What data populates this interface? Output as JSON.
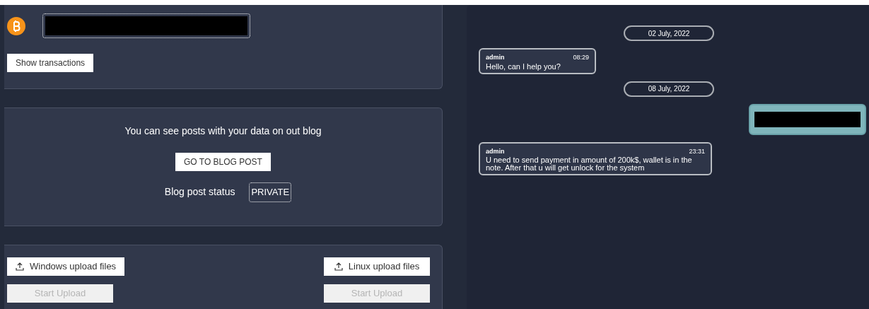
{
  "wallet": {
    "button": "Show transactions"
  },
  "blog": {
    "message": "You can see posts with your data on out blog",
    "button": "GO TO BLOG POST",
    "status_label": "Blog post status",
    "status": "PRIVATE"
  },
  "uploads": [
    {
      "label": "Windows upload files",
      "start": "Start Upload",
      "disabled": true
    },
    {
      "label": "Linux upload files",
      "start": "Start Upload",
      "disabled": true
    }
  ],
  "chat": [
    {
      "kind": "date",
      "text": "02 July, 2022"
    },
    {
      "kind": "incoming",
      "author": "admin",
      "time": "08:29",
      "text": "Hello, can I help you?"
    },
    {
      "kind": "date",
      "text": "08 July, 2022"
    },
    {
      "kind": "outgoing"
    },
    {
      "kind": "incoming",
      "author": "admin",
      "time": "23:31",
      "text": "U need to send payment in amount of 200k$, wallet is in the note. After that u will get unlock for the system"
    }
  ]
}
